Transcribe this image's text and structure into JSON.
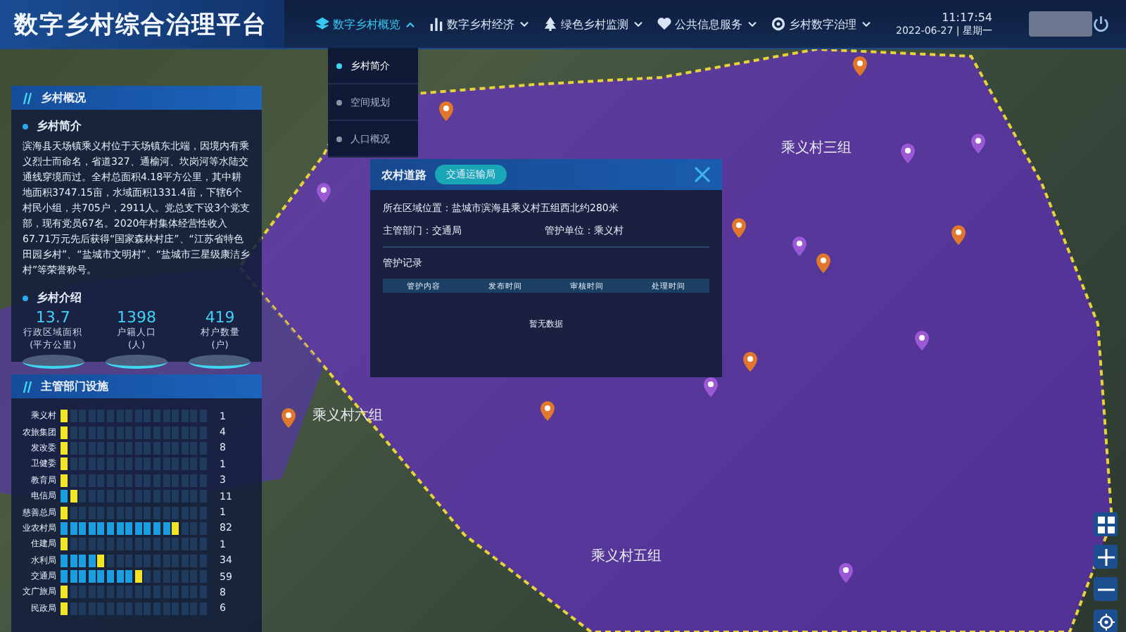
{
  "header": {
    "title": "数字乡村综合治理平台",
    "time": "11:17:54",
    "date": "2022-06-27 | 星期一"
  },
  "nav": [
    {
      "label": "数字乡村概览",
      "selected": true
    },
    {
      "label": "数字乡村经济",
      "selected": false
    },
    {
      "label": "绿色乡村监测",
      "selected": false
    },
    {
      "label": "公共信息服务",
      "selected": false
    },
    {
      "label": "乡村数字治理",
      "selected": false
    }
  ],
  "submenu": [
    {
      "label": "乡村简介",
      "selected": true
    },
    {
      "label": "空间规划",
      "selected": false
    },
    {
      "label": "人口概况",
      "selected": false
    }
  ],
  "map_labels": [
    "乘义村三组",
    "乘义村六组",
    "乘义村五组"
  ],
  "overview": {
    "title": "乡村概况",
    "intro_heading": "乡村简介",
    "intro": "滨海县天场镇乘义村位于天场镇东北端，因境内有乘义烈士而命名，省道327、通榆河、坎岗河等水陆交通线穿境而过。全村总面积4.18平方公里，其中耕地面积3747.15亩，水域面积1331.4亩，下辖6个村民小组，共705户，2911人。党总支下设3个党支部，现有党员67名。2020年村集体经营性收入67.71万元先后获得“国家森林村庄”、“江苏省特色田园乡村”、“盐城市文明村”、“盐城市三星级康洁乡村”等荣誉称号。",
    "stats_heading": "乡村介绍",
    "stats": [
      {
        "value": "13.7",
        "label": "行政区域面积",
        "unit": "(平方公里)"
      },
      {
        "value": "1398",
        "label": "户籍人口",
        "unit": "(人)"
      },
      {
        "value": "419",
        "label": "村户数量",
        "unit": "(户)"
      }
    ]
  },
  "facilities": {
    "title": "主管部门设施",
    "rows": [
      {
        "name": "乘义村",
        "count": "1",
        "level": 0.01
      },
      {
        "name": "农旅集团",
        "count": "4",
        "level": 0.04
      },
      {
        "name": "发改委",
        "count": "8",
        "level": 0.08
      },
      {
        "name": "卫健委",
        "count": "1",
        "level": 0.01
      },
      {
        "name": "教育局",
        "count": "3",
        "level": 0.03
      },
      {
        "name": "电信局",
        "count": "11",
        "level": 0.11
      },
      {
        "name": "慈善总局",
        "count": "1",
        "level": 0.01
      },
      {
        "name": "业农村局",
        "count": "82",
        "level": 0.82
      },
      {
        "name": "住建局",
        "count": "1",
        "level": 0.01
      },
      {
        "name": "水利局",
        "count": "34",
        "level": 0.34
      },
      {
        "name": "交通局",
        "count": "59",
        "level": 0.59
      },
      {
        "name": "文广旅局",
        "count": "8",
        "level": 0.08
      },
      {
        "name": "民政局",
        "count": "6",
        "level": 0.06
      }
    ]
  },
  "popup": {
    "title": "农村道路",
    "tag": "交通运输局",
    "location": "所在区域位置：盐城市滨海县乘义村五组西北约280米",
    "department": "主管部门：交通局",
    "unit": "管护单位：乘义村",
    "records_title": "管护记录",
    "columns": [
      "管护内容",
      "发布时间",
      "审核时间",
      "处理时间"
    ],
    "empty": "暂无数据"
  }
}
